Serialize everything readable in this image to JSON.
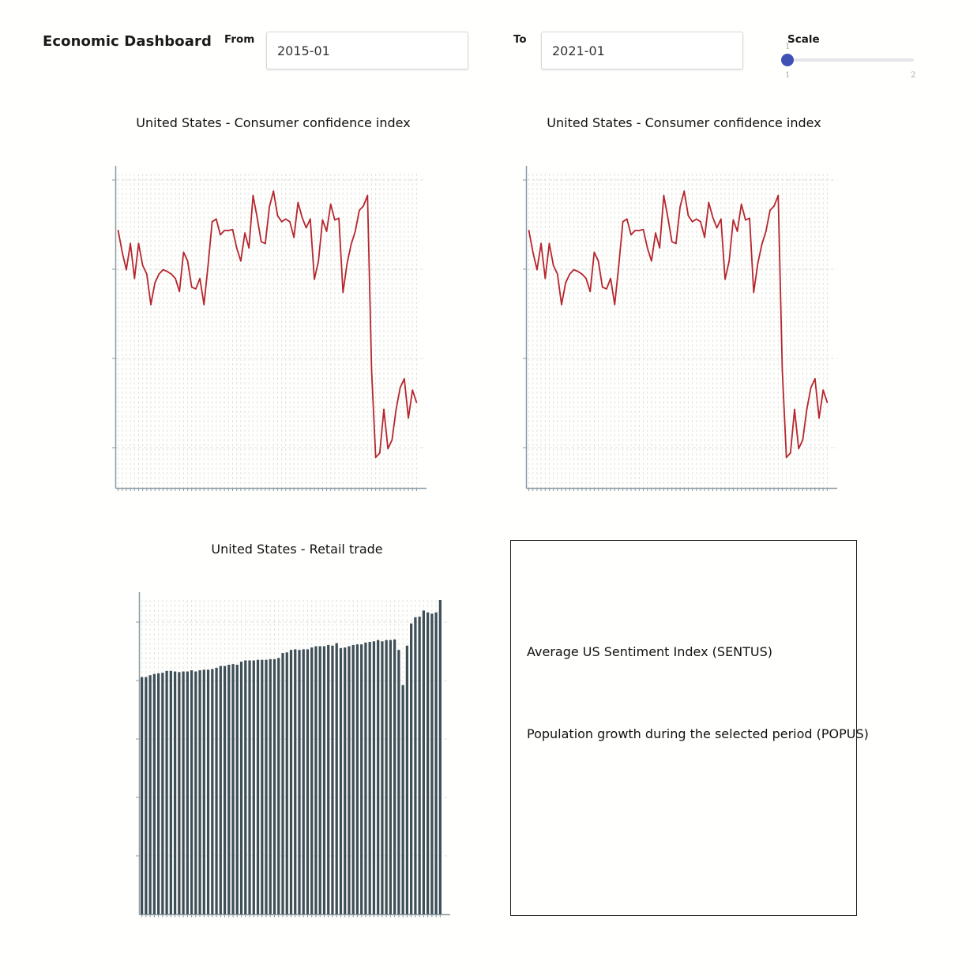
{
  "header": {
    "title": "Economic Dashboard",
    "from_label": "From",
    "from_value": "2015-01",
    "to_label": "To",
    "to_value": "2021-01",
    "scale_label": "Scale",
    "scale_value": 1,
    "scale_min": 1,
    "scale_max": 2,
    "scale_min_label": "1",
    "scale_max_label": "2",
    "scale_value_label": "1"
  },
  "charts": {
    "confidence_left_title": "United States - Consumer confidence index",
    "confidence_right_title": "United States - Consumer confidence index",
    "retail_title": "United States - Retail trade"
  },
  "info": {
    "sentiment_label": "Average US Sentiment Index (SENTUS)",
    "population_label": "Population growth during the selected period (POPUS)"
  },
  "colors": {
    "line": "#b5262e",
    "bar": "#3e4f58",
    "axis": "#8a9aa4",
    "grid": "#e2e2e2",
    "slider_thumb": "#3f51b5"
  },
  "chart_data": [
    {
      "type": "line",
      "title": "United States - Consumer confidence index",
      "x_start": "2015-01",
      "x_end": "2021-01",
      "ylim": [
        97.5,
        101.1
      ],
      "grid": true,
      "series": [
        {
          "values": [
            100.45,
            100.2,
            100.0,
            100.3,
            99.9,
            100.3,
            100.05,
            99.95,
            99.6,
            99.85,
            99.95,
            100.0,
            99.98,
            99.95,
            99.9,
            99.75,
            100.2,
            100.1,
            99.8,
            99.78,
            99.9,
            99.6,
            100.05,
            100.55,
            100.58,
            100.4,
            100.45,
            100.45,
            100.46,
            100.25,
            100.1,
            100.42,
            100.25,
            100.85,
            100.6,
            100.32,
            100.3,
            100.72,
            100.9,
            100.62,
            100.55,
            100.58,
            100.55,
            100.37,
            100.77,
            100.6,
            100.48,
            100.58,
            99.89,
            100.1,
            100.57,
            100.44,
            100.75,
            100.57,
            100.59,
            99.74,
            100.07,
            100.29,
            100.44,
            100.68,
            100.73,
            100.85,
            98.85,
            97.85,
            97.9,
            98.4,
            97.95,
            98.05,
            98.4,
            98.65,
            98.75,
            98.3,
            98.62,
            98.48
          ]
        }
      ]
    },
    {
      "type": "line",
      "title": "United States - Consumer confidence index",
      "x_start": "2015-01",
      "x_end": "2021-01",
      "ylim": [
        97.5,
        101.1
      ],
      "grid": true,
      "series": [
        {
          "values": [
            100.45,
            100.2,
            100.0,
            100.3,
            99.9,
            100.3,
            100.05,
            99.95,
            99.6,
            99.85,
            99.95,
            100.0,
            99.98,
            99.95,
            99.9,
            99.75,
            100.2,
            100.1,
            99.8,
            99.78,
            99.9,
            99.6,
            100.05,
            100.55,
            100.58,
            100.4,
            100.45,
            100.45,
            100.46,
            100.25,
            100.1,
            100.42,
            100.25,
            100.85,
            100.6,
            100.32,
            100.3,
            100.72,
            100.9,
            100.62,
            100.55,
            100.58,
            100.55,
            100.37,
            100.77,
            100.6,
            100.48,
            100.58,
            99.89,
            100.1,
            100.57,
            100.44,
            100.75,
            100.57,
            100.59,
            99.74,
            100.07,
            100.29,
            100.44,
            100.68,
            100.73,
            100.85,
            98.85,
            97.85,
            97.9,
            98.4,
            97.95,
            98.05,
            98.4,
            98.65,
            98.75,
            98.3,
            98.62,
            98.48
          ]
        }
      ]
    },
    {
      "type": "bar",
      "title": "United States - Retail trade",
      "x_start": "2015-01",
      "x_end": "2021-01",
      "ylim": [
        0,
        510
      ],
      "grid": true,
      "series": [
        {
          "values": [
            385,
            385,
            388,
            390,
            391,
            392,
            395,
            395,
            394,
            393,
            394,
            394,
            396,
            394,
            396,
            397,
            397,
            398,
            400,
            403,
            403,
            405,
            406,
            405,
            410,
            412,
            412,
            412,
            413,
            413,
            413,
            414,
            414,
            416,
            424,
            425,
            429,
            430,
            429,
            430,
            430,
            433,
            435,
            435,
            435,
            437,
            436,
            440,
            432,
            433,
            435,
            437,
            438,
            438,
            441,
            442,
            443,
            445,
            443,
            445,
            445,
            446,
            429,
            372,
            436,
            472,
            482,
            483,
            493,
            490,
            488,
            490,
            510
          ]
        }
      ]
    }
  ]
}
